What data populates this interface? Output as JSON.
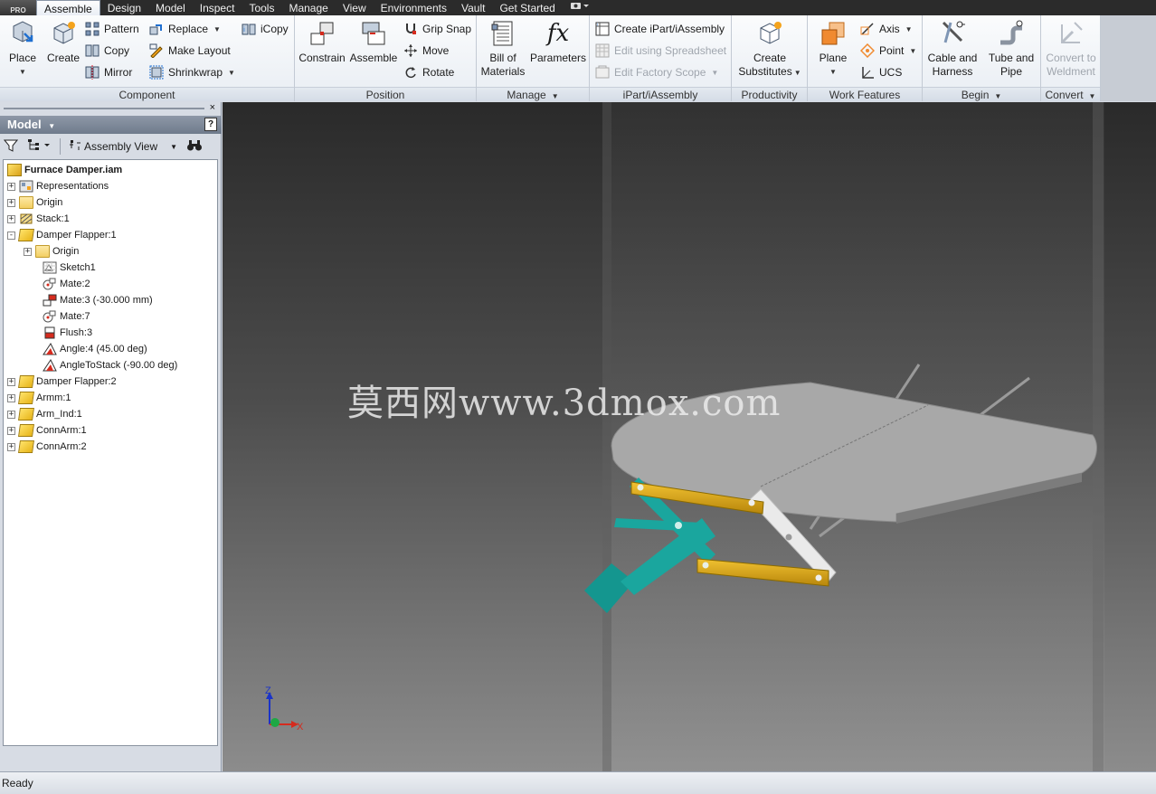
{
  "menubar": {
    "app_badge": "PRO",
    "tabs": [
      {
        "label": "Assemble",
        "active": true
      },
      {
        "label": "Design"
      },
      {
        "label": "Model"
      },
      {
        "label": "Inspect"
      },
      {
        "label": "Tools"
      },
      {
        "label": "Manage"
      },
      {
        "label": "View"
      },
      {
        "label": "Environments"
      },
      {
        "label": "Vault"
      },
      {
        "label": "Get Started"
      }
    ],
    "extra_icon": "camera-icon"
  },
  "ribbon": {
    "component": {
      "title": "Component",
      "place": "Place",
      "create": "Create",
      "pattern": "Pattern",
      "copy": "Copy",
      "mirror": "Mirror",
      "replace": "Replace",
      "make_layout": "Make Layout",
      "shrinkwrap": "Shrinkwrap",
      "icopy": "iCopy"
    },
    "position": {
      "title": "Position",
      "constrain": "Constrain",
      "assemble": "Assemble",
      "grip_snap": "Grip Snap",
      "move": "Move",
      "rotate": "Rotate"
    },
    "manage": {
      "title": "Manage",
      "bom_line1": "Bill of",
      "bom_line2": "Materials",
      "parameters": "Parameters",
      "fx": "fx"
    },
    "ipart": {
      "title": "iPart/iAssembly",
      "create": "Create iPart/iAssembly",
      "edit_spreadsheet": "Edit using Spreadsheet",
      "edit_factory": "Edit Factory Scope"
    },
    "productivity": {
      "title": "Productivity",
      "line1": "Create",
      "line2": "Substitutes"
    },
    "work_features": {
      "title": "Work Features",
      "plane": "Plane",
      "axis": "Axis",
      "point": "Point",
      "ucs": "UCS"
    },
    "begin": {
      "title": "Begin",
      "cable_line1": "Cable and",
      "cable_line2": "Harness",
      "tube_line1": "Tube and",
      "tube_line2": "Pipe"
    },
    "convert": {
      "title": "Convert",
      "line1": "Convert to",
      "line2": "Weldment"
    }
  },
  "model_pane": {
    "close": "×",
    "title": "Model",
    "help": "?",
    "view_selector": "Assembly View",
    "tree": [
      {
        "label": "Furnace Damper.iam",
        "level": 0,
        "bold": true,
        "icon": "assembly-icon",
        "expander": "-"
      },
      {
        "label": "Representations",
        "level": 0,
        "icon": "representations-icon",
        "expander": "+"
      },
      {
        "label": "Origin",
        "level": 0,
        "icon": "folder-icon",
        "expander": "+"
      },
      {
        "label": "Stack:1",
        "level": 0,
        "icon": "grounded-part-icon",
        "expander": "+"
      },
      {
        "label": "Damper Flapper:1",
        "level": 0,
        "icon": "part-icon",
        "expander": "-"
      },
      {
        "label": "Origin",
        "level": 1,
        "icon": "folder-icon",
        "expander": "+"
      },
      {
        "label": "Sketch1",
        "level": 1,
        "icon": "sketch-icon",
        "expander": ""
      },
      {
        "label": "Mate:2",
        "level": 1,
        "icon": "mate-icon",
        "expander": ""
      },
      {
        "label": "Mate:3 (-30.000 mm)",
        "level": 1,
        "icon": "mate-offset-icon",
        "expander": ""
      },
      {
        "label": "Mate:7",
        "level": 1,
        "icon": "mate-icon",
        "expander": ""
      },
      {
        "label": "Flush:3",
        "level": 1,
        "icon": "flush-icon",
        "expander": ""
      },
      {
        "label": "Angle:4 (45.00 deg)",
        "level": 1,
        "icon": "angle-icon",
        "expander": ""
      },
      {
        "label": "AngleToStack (-90.00 deg)",
        "level": 1,
        "icon": "angle-icon",
        "expander": ""
      },
      {
        "label": "Damper Flapper:2",
        "level": 0,
        "icon": "part-icon",
        "expander": "+"
      },
      {
        "label": "Armm:1",
        "level": 0,
        "icon": "part-icon",
        "expander": "+"
      },
      {
        "label": "Arm_Ind:1",
        "level": 0,
        "icon": "part-icon",
        "expander": "+"
      },
      {
        "label": "ConnArm:1",
        "level": 0,
        "icon": "part-icon",
        "expander": "+"
      },
      {
        "label": "ConnArm:2",
        "level": 0,
        "icon": "part-icon",
        "expander": "+"
      }
    ]
  },
  "viewport": {
    "watermark": "莫西网www.3dmox.com",
    "triad": {
      "z": "Z",
      "x": "X"
    }
  },
  "status": {
    "text": "Ready"
  }
}
